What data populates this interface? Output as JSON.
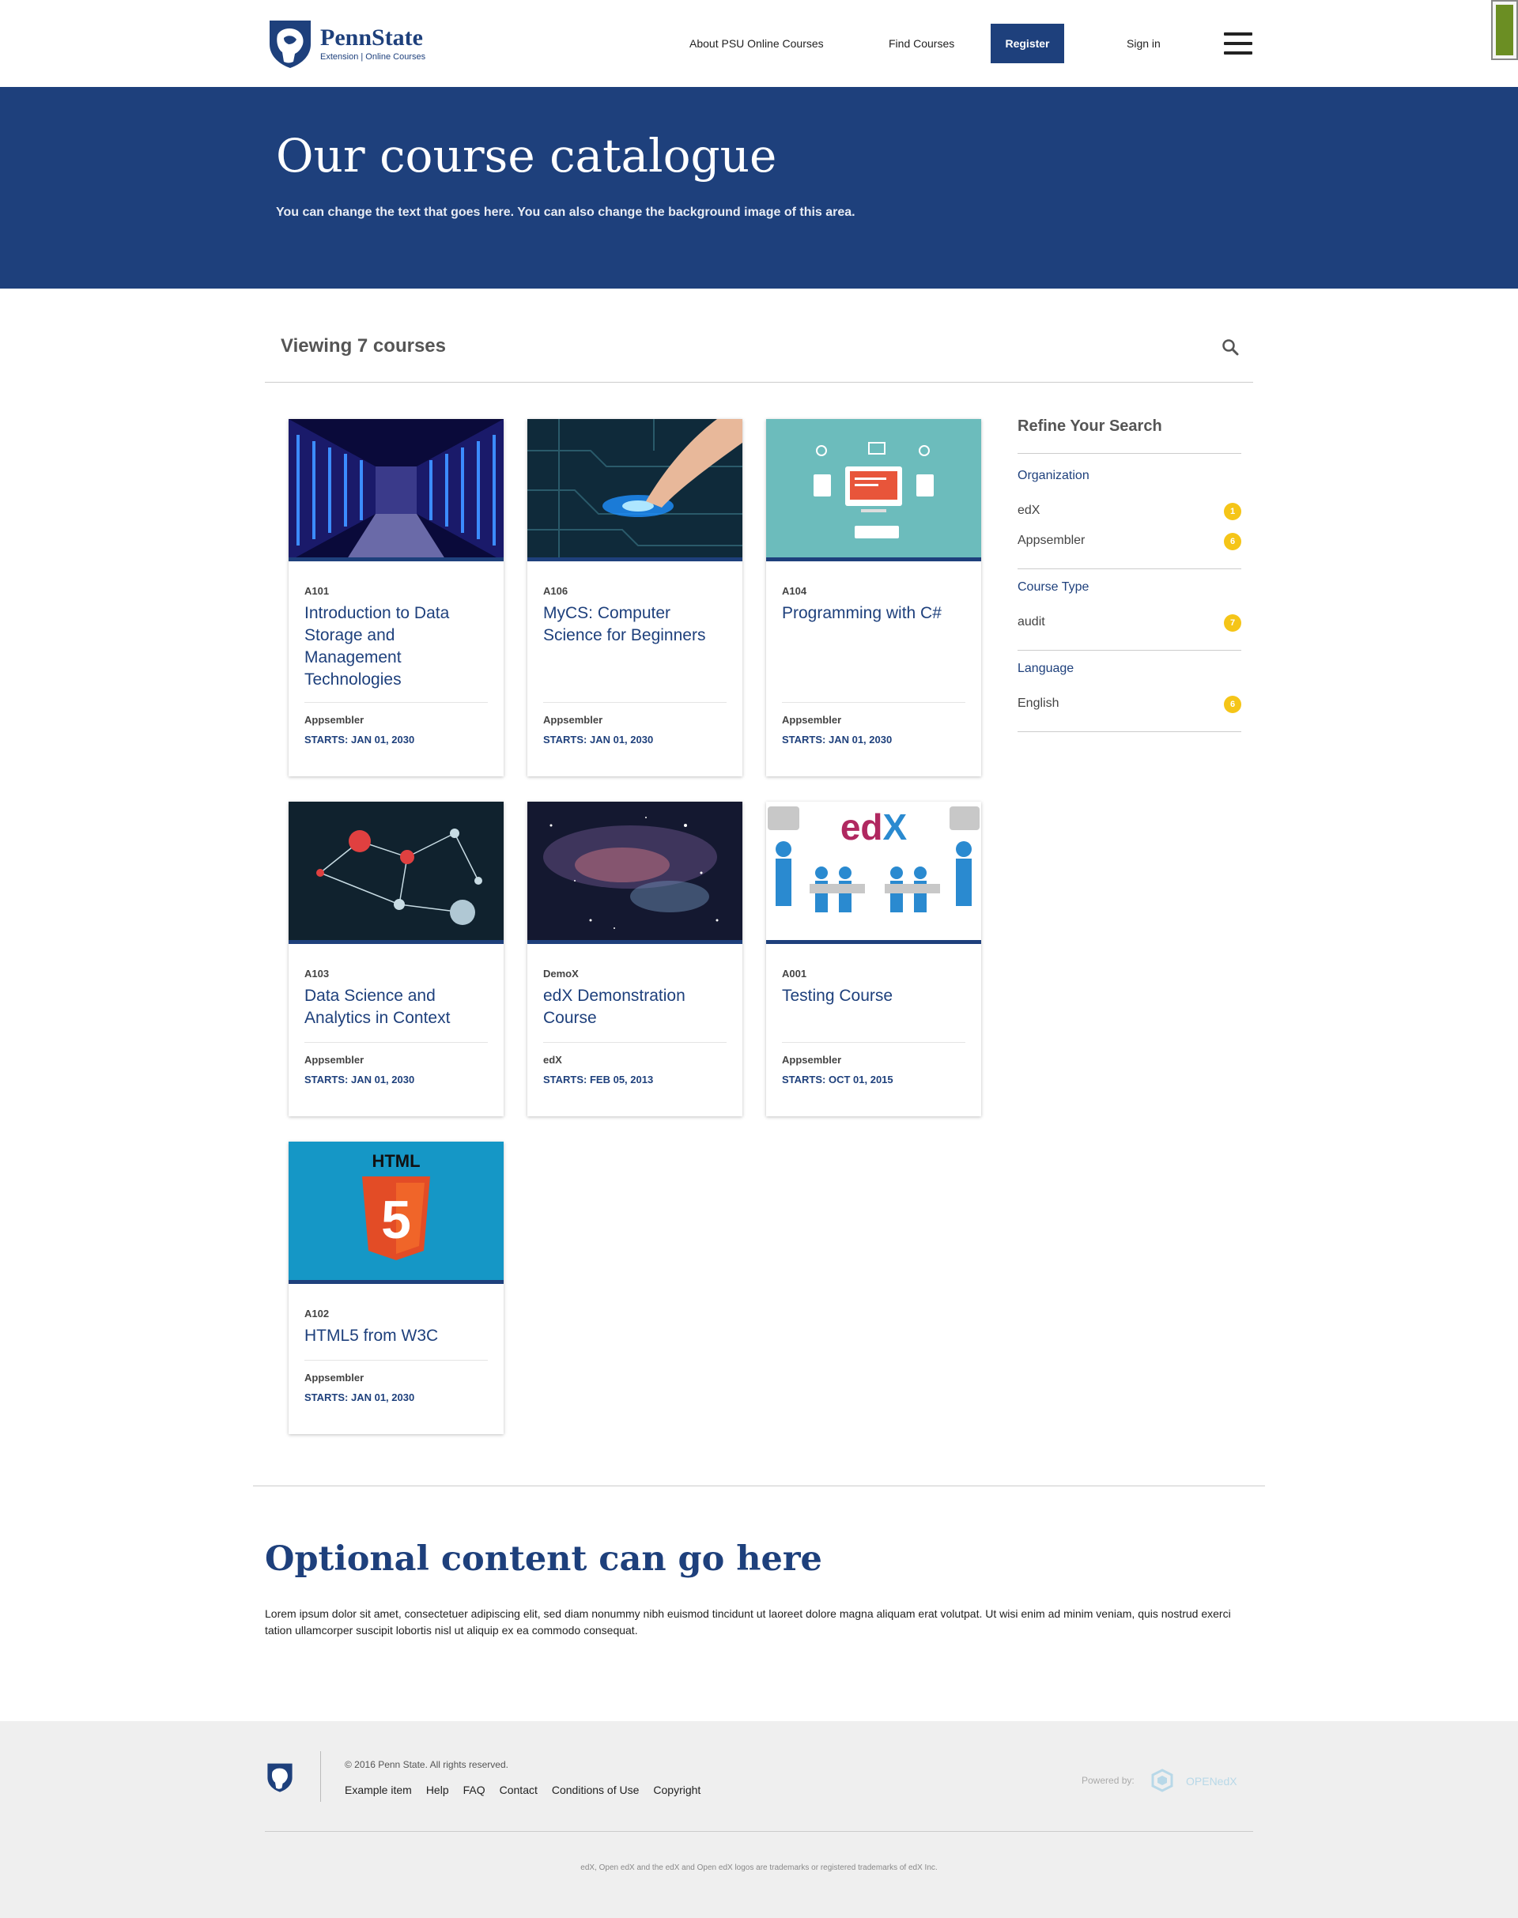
{
  "header": {
    "logo": {
      "name": "PennState",
      "subtitle": "Extension | Online Courses"
    },
    "nav": {
      "about": "About PSU Online Courses",
      "find": "Find Courses",
      "register": "Register",
      "signin": "Sign in"
    }
  },
  "hero": {
    "title": "Our course catalogue",
    "subtitle": "You can change the text that goes here. You can also change the background image of this area."
  },
  "catalog": {
    "viewing": "Viewing 7 courses",
    "courses": [
      {
        "code": "A101",
        "title": "Introduction to Data Storage and Management Technologies",
        "org": "Appsembler",
        "start": "STARTS: JAN 01, 2030",
        "image": "datacenter"
      },
      {
        "code": "A106",
        "title": "MyCS: Computer Science for Beginners",
        "org": "Appsembler",
        "start": "STARTS: JAN 01, 2030",
        "image": "circuit-hand"
      },
      {
        "code": "A104",
        "title": "Programming with C#",
        "org": "Appsembler",
        "start": "STARTS: JAN 01, 2030",
        "image": "computer-illustration"
      },
      {
        "code": "A103",
        "title": "Data Science and Analytics in Context",
        "org": "Appsembler",
        "start": "STARTS: JAN 01, 2030",
        "image": "network-graph"
      },
      {
        "code": "DemoX",
        "title": "edX Demonstration Course",
        "org": "edX",
        "start": "STARTS: FEB 05, 2013",
        "image": "galaxy"
      },
      {
        "code": "A001",
        "title": "Testing Course",
        "org": "Appsembler",
        "start": "STARTS: OCT 01, 2015",
        "image": "edx-puzzle"
      },
      {
        "code": "A102",
        "title": "HTML5 from W3C",
        "org": "Appsembler",
        "start": "STARTS: JAN 01, 2030",
        "image": "html5"
      }
    ]
  },
  "sidebar": {
    "title": "Refine Your Search",
    "facets": [
      {
        "heading": "Organization",
        "items": [
          {
            "label": "edX",
            "count": "1"
          },
          {
            "label": "Appsembler",
            "count": "6"
          }
        ]
      },
      {
        "heading": "Course Type",
        "items": [
          {
            "label": "audit",
            "count": "7"
          }
        ]
      },
      {
        "heading": "Language",
        "items": [
          {
            "label": "English",
            "count": "6"
          }
        ]
      }
    ]
  },
  "optional": {
    "title": "Optional content can go here",
    "text": "Lorem ipsum dolor sit amet, consectetuer adipiscing elit, sed diam nonummy nibh euismod tincidunt ut laoreet dolore magna aliquam erat volutpat. Ut wisi enim ad minim veniam, quis nostrud exerci tation ullamcorper suscipit lobortis nisl ut aliquip ex ea commodo consequat."
  },
  "footer": {
    "copyright": "© 2016 Penn State. All rights reserved.",
    "links": [
      "Example item",
      "Help",
      "FAQ",
      "Contact",
      "Conditions of Use",
      "Copyright"
    ],
    "powered_by": "Powered by:",
    "openedx_logo_text": "OPENedX",
    "trademark": "edX, Open edX and the edX and Open edX logos are trademarks or registered trademarks of edX Inc."
  },
  "colors": {
    "brand": "#1e407c",
    "badge": "#f5c518",
    "footer_bg": "#efefef"
  }
}
